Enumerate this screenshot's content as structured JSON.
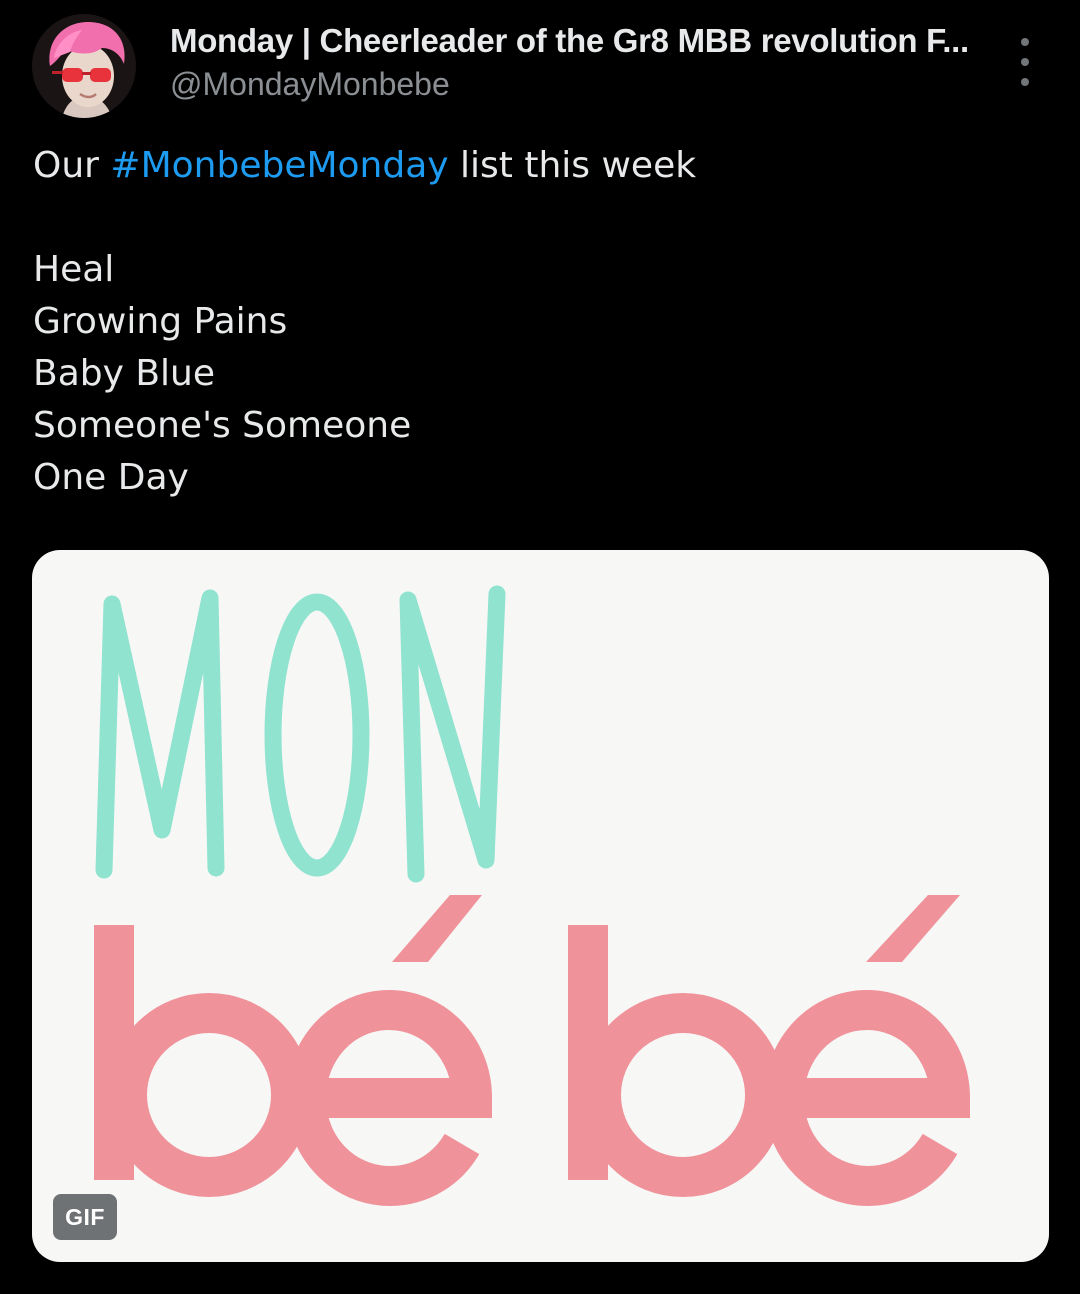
{
  "author": {
    "display_name": "Monday | Cheerleader of the Gr8 MBB revolution F...",
    "handle": "@MondayMonbebe"
  },
  "tweet": {
    "intro_before": "Our ",
    "hashtag": "#MonbebeMonday",
    "intro_after": " list this week",
    "songs": [
      "Heal",
      "Growing Pains",
      "Baby Blue",
      "Someone's Someone",
      "One Day"
    ]
  },
  "media": {
    "logo_top": "MON",
    "logo_bottom": "bébé",
    "badge": "GIF"
  },
  "colors": {
    "background": "#000000",
    "text": "#e7e9ea",
    "secondary_text": "#8b8f94",
    "link": "#1d9bf0",
    "mint": "#8fe3cf",
    "pink": "#f0929a"
  },
  "icons": {
    "more": "more-vertical-icon",
    "avatar": "profile-avatar"
  }
}
